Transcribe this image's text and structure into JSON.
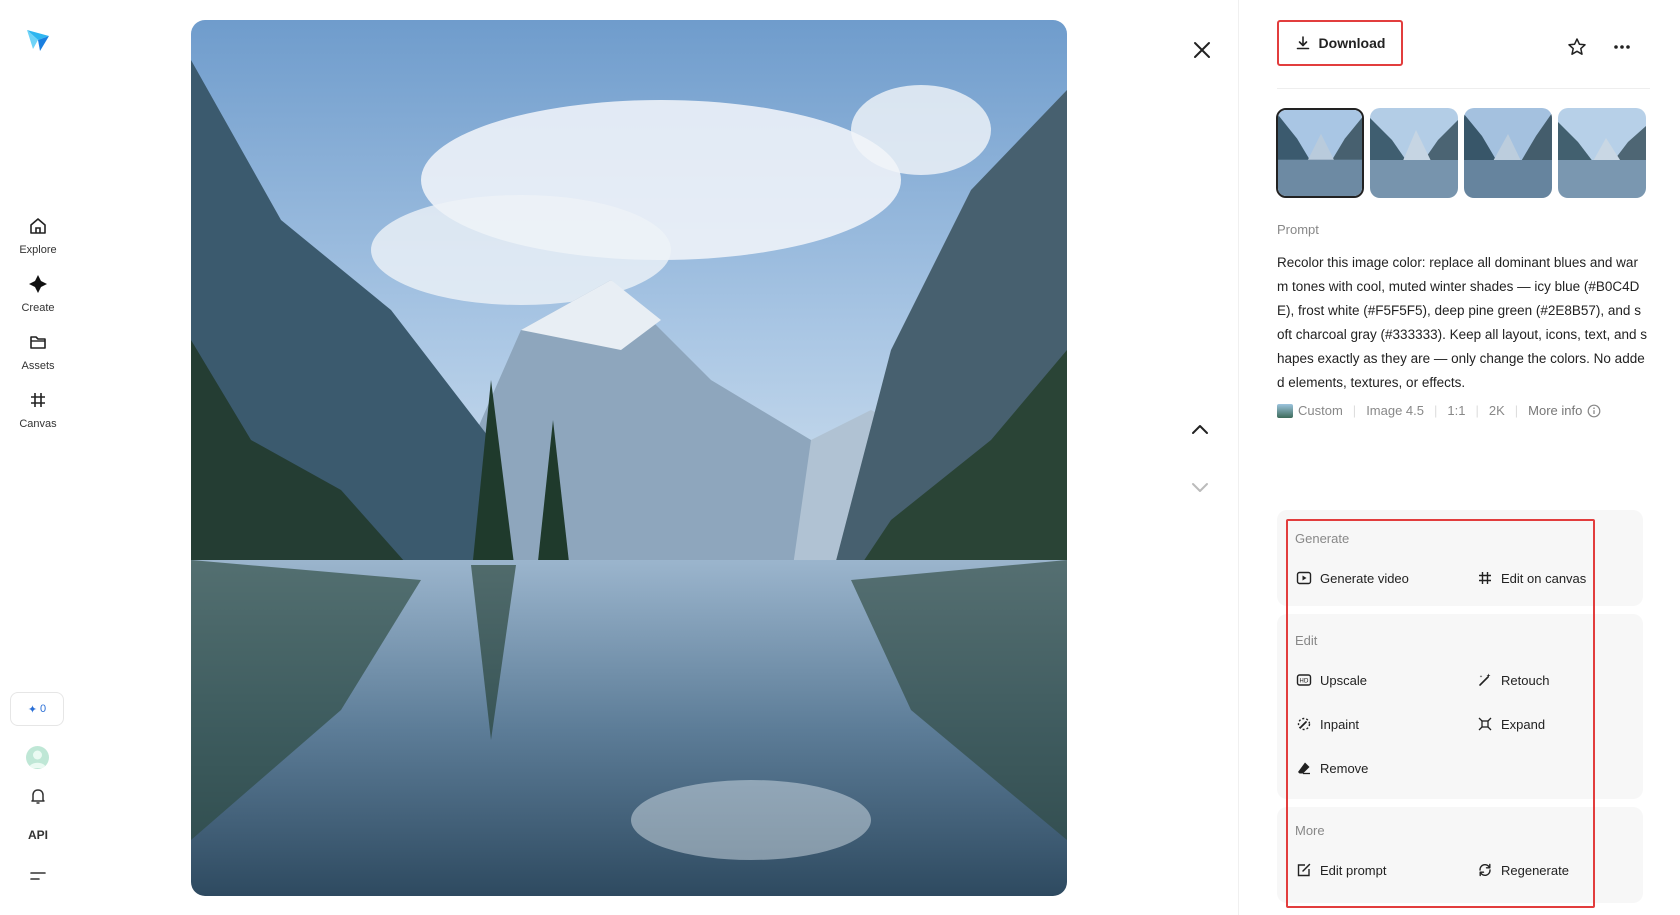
{
  "nav": {
    "items": [
      {
        "label": "Explore",
        "icon": "home-icon"
      },
      {
        "label": "Create",
        "icon": "sparkle-icon"
      },
      {
        "label": "Assets",
        "icon": "folder-icon"
      },
      {
        "label": "Canvas",
        "icon": "canvas-icon"
      }
    ],
    "credits": "0",
    "api_label": "API"
  },
  "toolbar": {
    "download_label": "Download"
  },
  "thumbnails": {
    "count": 4,
    "selected_index": 0
  },
  "prompt": {
    "label": "Prompt",
    "text": "Recolor this image color: replace all dominant blues and warm tones with cool, muted winter shades — icy blue (#B0C4DE), frost white (#F5F5F5), deep pine green (#2E8B57), and soft charcoal gray (#333333). Keep all layout, icons, text, and shapes exactly as they are — only change the colors. No added elements, textures, or effects."
  },
  "meta": {
    "style": "Custom",
    "model": "Image 4.5",
    "ratio": "1:1",
    "resolution": "2K",
    "more_info": "More info"
  },
  "actions": {
    "generate": {
      "title": "Generate",
      "items": [
        "Generate video",
        "Edit on canvas"
      ]
    },
    "edit": {
      "title": "Edit",
      "items": [
        "Upscale",
        "Retouch",
        "Inpaint",
        "Expand",
        "Remove"
      ]
    },
    "more": {
      "title": "More",
      "items": [
        "Edit prompt",
        "Regenerate"
      ]
    }
  },
  "colors": {
    "highlight": "#e23d3d",
    "accent": "#2a6fd6"
  }
}
